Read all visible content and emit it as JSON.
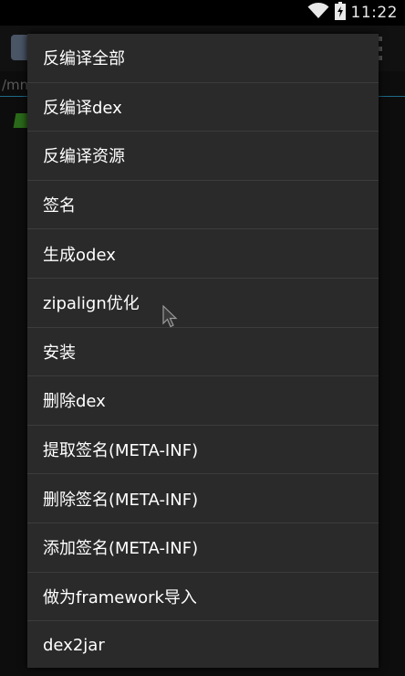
{
  "status_bar": {
    "time": "11:22",
    "icons": [
      "wifi-icon",
      "battery-icon"
    ]
  },
  "background_app": {
    "path_text": "/mn"
  },
  "menu": {
    "items": [
      {
        "label": "反编译全部"
      },
      {
        "label": "反编译dex"
      },
      {
        "label": "反编译资源"
      },
      {
        "label": "签名"
      },
      {
        "label": "生成odex"
      },
      {
        "label": "zipalign优化"
      },
      {
        "label": "安装"
      },
      {
        "label": "删除dex"
      },
      {
        "label": "提取签名(META-INF)"
      },
      {
        "label": "删除签名(META-INF)"
      },
      {
        "label": "添加签名(META-INF)"
      },
      {
        "label": "做为framework导入"
      },
      {
        "label": "dex2jar"
      }
    ]
  },
  "colors": {
    "menu_background": "#2a2a2a",
    "divider": "#3c3c3c",
    "text": "#ffffff",
    "accent": "#1d6a8a"
  },
  "cursor": {
    "icon": "mouse-pointer-icon"
  }
}
